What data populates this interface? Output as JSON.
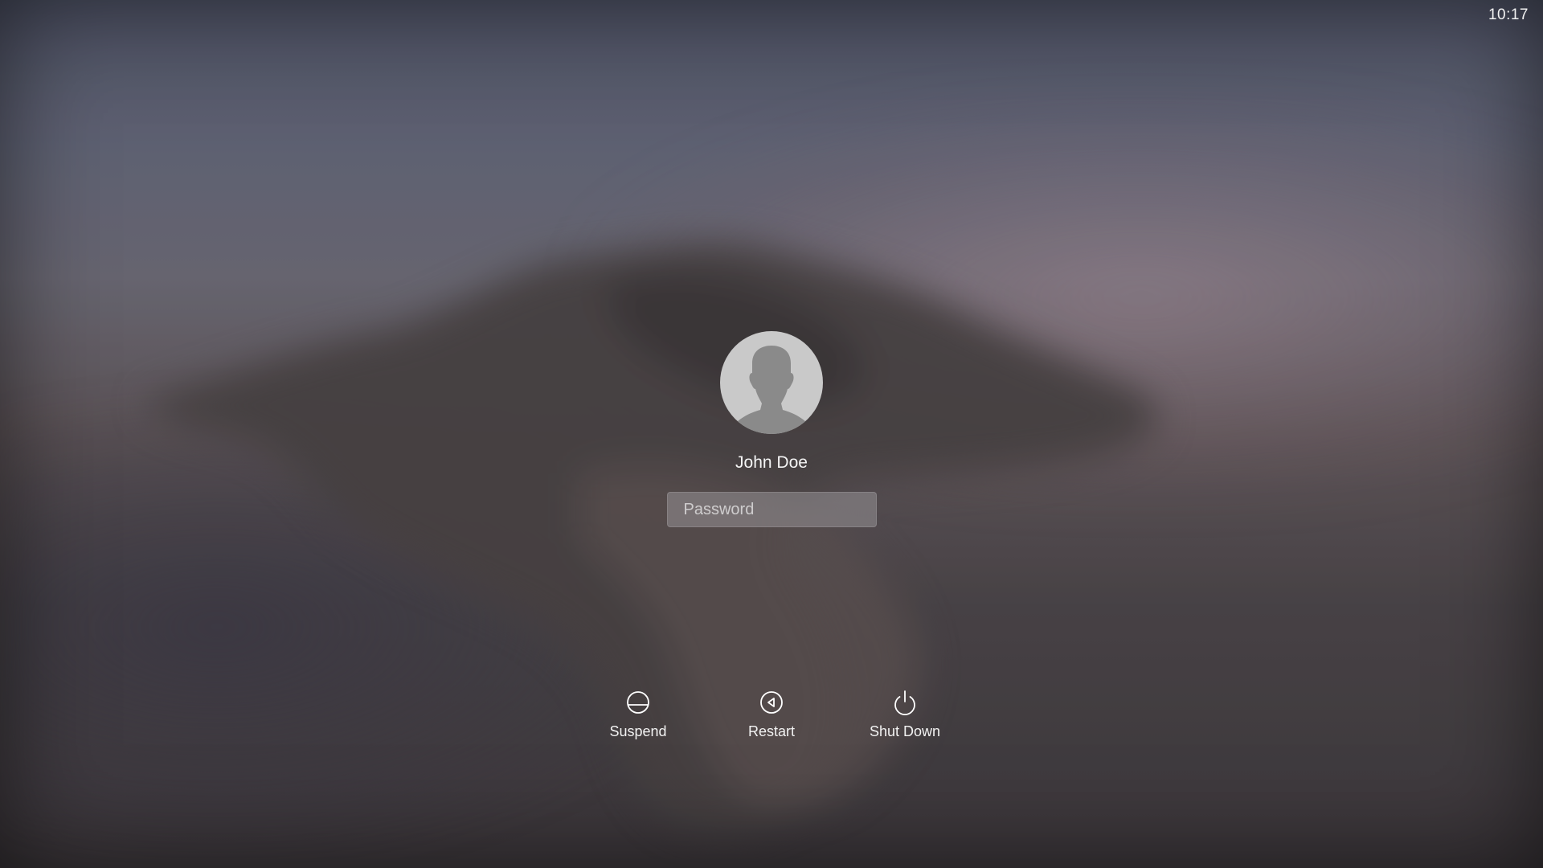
{
  "status_bar": {
    "time": "10:17"
  },
  "login": {
    "user_name": "John Doe",
    "avatar_icon": "user-silhouette-icon",
    "password": {
      "value": "",
      "placeholder": "Password"
    }
  },
  "power_actions": [
    {
      "label": "Suspend",
      "icon": "suspend-icon"
    },
    {
      "label": "Restart",
      "icon": "restart-icon"
    },
    {
      "label": "Shut Down",
      "icon": "power-icon"
    }
  ],
  "colors": {
    "text": "#ffffff",
    "avatar_background": "#c9c9c9",
    "avatar_silhouette": "#8a8a8a"
  }
}
